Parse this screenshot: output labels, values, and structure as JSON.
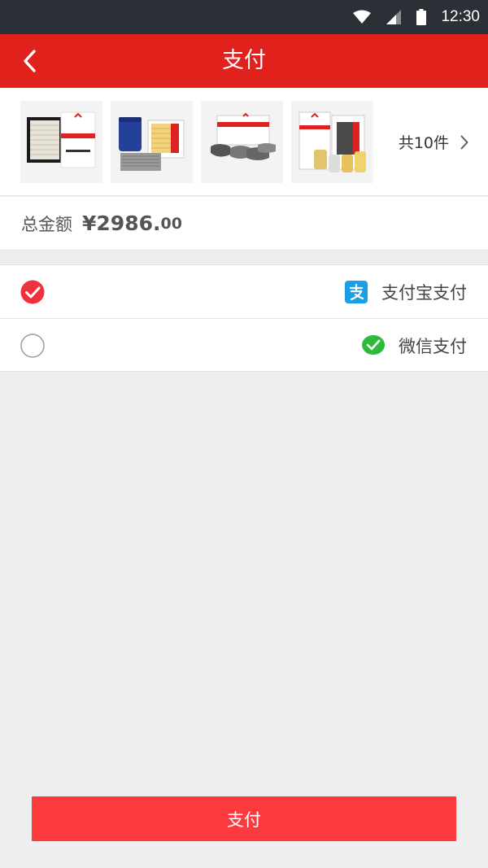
{
  "status_bar": {
    "time": "12:30"
  },
  "header": {
    "title": "支付",
    "back_icon": "chevron-left-icon"
  },
  "products": {
    "thumbnails": [
      {
        "name": "air-filter"
      },
      {
        "name": "oil-and-air-filter"
      },
      {
        "name": "brake-pads"
      },
      {
        "name": "filter-kit"
      }
    ],
    "count_label": "共10件"
  },
  "total": {
    "label": "总金额",
    "currency": "¥",
    "integer": "2986.",
    "cents": "00"
  },
  "payment_methods": [
    {
      "label": "支付宝支付",
      "icon": "alipay-icon",
      "selected": true
    },
    {
      "label": "微信支付",
      "icon": "wechat-pay-icon",
      "selected": false
    }
  ],
  "pay_button": {
    "label": "支付"
  },
  "colors": {
    "header": "#e1211c",
    "button": "#fd3b3f",
    "alipay": "#1a9fe6",
    "wechat": "#2dbb3b"
  }
}
